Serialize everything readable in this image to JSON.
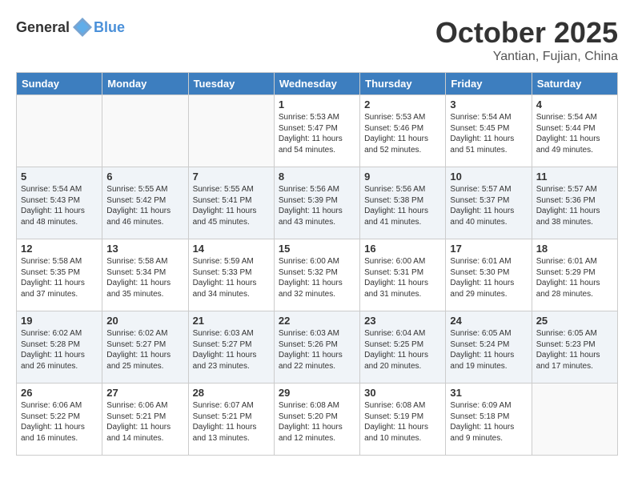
{
  "header": {
    "logo_general": "General",
    "logo_blue": "Blue",
    "month": "October 2025",
    "location": "Yantian, Fujian, China"
  },
  "weekdays": [
    "Sunday",
    "Monday",
    "Tuesday",
    "Wednesday",
    "Thursday",
    "Friday",
    "Saturday"
  ],
  "weeks": [
    [
      {
        "day": "",
        "info": ""
      },
      {
        "day": "",
        "info": ""
      },
      {
        "day": "",
        "info": ""
      },
      {
        "day": "1",
        "info": "Sunrise: 5:53 AM\nSunset: 5:47 PM\nDaylight: 11 hours\nand 54 minutes."
      },
      {
        "day": "2",
        "info": "Sunrise: 5:53 AM\nSunset: 5:46 PM\nDaylight: 11 hours\nand 52 minutes."
      },
      {
        "day": "3",
        "info": "Sunrise: 5:54 AM\nSunset: 5:45 PM\nDaylight: 11 hours\nand 51 minutes."
      },
      {
        "day": "4",
        "info": "Sunrise: 5:54 AM\nSunset: 5:44 PM\nDaylight: 11 hours\nand 49 minutes."
      }
    ],
    [
      {
        "day": "5",
        "info": "Sunrise: 5:54 AM\nSunset: 5:43 PM\nDaylight: 11 hours\nand 48 minutes."
      },
      {
        "day": "6",
        "info": "Sunrise: 5:55 AM\nSunset: 5:42 PM\nDaylight: 11 hours\nand 46 minutes."
      },
      {
        "day": "7",
        "info": "Sunrise: 5:55 AM\nSunset: 5:41 PM\nDaylight: 11 hours\nand 45 minutes."
      },
      {
        "day": "8",
        "info": "Sunrise: 5:56 AM\nSunset: 5:39 PM\nDaylight: 11 hours\nand 43 minutes."
      },
      {
        "day": "9",
        "info": "Sunrise: 5:56 AM\nSunset: 5:38 PM\nDaylight: 11 hours\nand 41 minutes."
      },
      {
        "day": "10",
        "info": "Sunrise: 5:57 AM\nSunset: 5:37 PM\nDaylight: 11 hours\nand 40 minutes."
      },
      {
        "day": "11",
        "info": "Sunrise: 5:57 AM\nSunset: 5:36 PM\nDaylight: 11 hours\nand 38 minutes."
      }
    ],
    [
      {
        "day": "12",
        "info": "Sunrise: 5:58 AM\nSunset: 5:35 PM\nDaylight: 11 hours\nand 37 minutes."
      },
      {
        "day": "13",
        "info": "Sunrise: 5:58 AM\nSunset: 5:34 PM\nDaylight: 11 hours\nand 35 minutes."
      },
      {
        "day": "14",
        "info": "Sunrise: 5:59 AM\nSunset: 5:33 PM\nDaylight: 11 hours\nand 34 minutes."
      },
      {
        "day": "15",
        "info": "Sunrise: 6:00 AM\nSunset: 5:32 PM\nDaylight: 11 hours\nand 32 minutes."
      },
      {
        "day": "16",
        "info": "Sunrise: 6:00 AM\nSunset: 5:31 PM\nDaylight: 11 hours\nand 31 minutes."
      },
      {
        "day": "17",
        "info": "Sunrise: 6:01 AM\nSunset: 5:30 PM\nDaylight: 11 hours\nand 29 minutes."
      },
      {
        "day": "18",
        "info": "Sunrise: 6:01 AM\nSunset: 5:29 PM\nDaylight: 11 hours\nand 28 minutes."
      }
    ],
    [
      {
        "day": "19",
        "info": "Sunrise: 6:02 AM\nSunset: 5:28 PM\nDaylight: 11 hours\nand 26 minutes."
      },
      {
        "day": "20",
        "info": "Sunrise: 6:02 AM\nSunset: 5:27 PM\nDaylight: 11 hours\nand 25 minutes."
      },
      {
        "day": "21",
        "info": "Sunrise: 6:03 AM\nSunset: 5:27 PM\nDaylight: 11 hours\nand 23 minutes."
      },
      {
        "day": "22",
        "info": "Sunrise: 6:03 AM\nSunset: 5:26 PM\nDaylight: 11 hours\nand 22 minutes."
      },
      {
        "day": "23",
        "info": "Sunrise: 6:04 AM\nSunset: 5:25 PM\nDaylight: 11 hours\nand 20 minutes."
      },
      {
        "day": "24",
        "info": "Sunrise: 6:05 AM\nSunset: 5:24 PM\nDaylight: 11 hours\nand 19 minutes."
      },
      {
        "day": "25",
        "info": "Sunrise: 6:05 AM\nSunset: 5:23 PM\nDaylight: 11 hours\nand 17 minutes."
      }
    ],
    [
      {
        "day": "26",
        "info": "Sunrise: 6:06 AM\nSunset: 5:22 PM\nDaylight: 11 hours\nand 16 minutes."
      },
      {
        "day": "27",
        "info": "Sunrise: 6:06 AM\nSunset: 5:21 PM\nDaylight: 11 hours\nand 14 minutes."
      },
      {
        "day": "28",
        "info": "Sunrise: 6:07 AM\nSunset: 5:21 PM\nDaylight: 11 hours\nand 13 minutes."
      },
      {
        "day": "29",
        "info": "Sunrise: 6:08 AM\nSunset: 5:20 PM\nDaylight: 11 hours\nand 12 minutes."
      },
      {
        "day": "30",
        "info": "Sunrise: 6:08 AM\nSunset: 5:19 PM\nDaylight: 11 hours\nand 10 minutes."
      },
      {
        "day": "31",
        "info": "Sunrise: 6:09 AM\nSunset: 5:18 PM\nDaylight: 11 hours\nand 9 minutes."
      },
      {
        "day": "",
        "info": ""
      }
    ]
  ]
}
